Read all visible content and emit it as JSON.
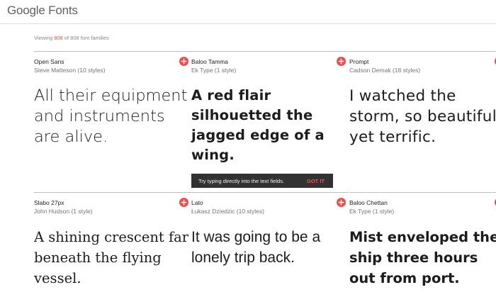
{
  "header": {
    "logo_text": "Google Fonts"
  },
  "status": {
    "prefix": "Viewing ",
    "count": "808",
    "suffix": " of 808 font families"
  },
  "cards": [
    {
      "font_name": "Open Sans",
      "designer": "Steve Matteson (10 styles)",
      "sample": "All their equipment and instruments are alive."
    },
    {
      "font_name": "Baloo Tamma",
      "designer": "Ek Type (1 style)",
      "sample": "A red flair silhouetted the jagged edge of a wing."
    },
    {
      "font_name": "Prompt",
      "designer": "Cadson Demak (18 styles)",
      "sample": "I watched the storm, so beautiful yet terrific."
    },
    {
      "font_name": "Slabo 27px",
      "designer": "John Hudson (1 style)",
      "sample": "A shining crescent far beneath the flying vessel."
    },
    {
      "font_name": "Lato",
      "designer": "Łukasz Dziedzic (10 styles)",
      "sample": "It was going to be a lonely trip back."
    },
    {
      "font_name": "Baloo Chettan",
      "designer": "Ek Type (1 style)",
      "sample": "Mist enveloped the ship three hours out from port."
    }
  ],
  "toast": {
    "message": "Try typing directly into the text fields.",
    "action": "GOT IT"
  },
  "colors": {
    "accent": "#ef4b4b",
    "toast_bg": "#323232",
    "divider": "#bdbdbd"
  },
  "icons": {
    "add": "plus-circle-icon"
  }
}
